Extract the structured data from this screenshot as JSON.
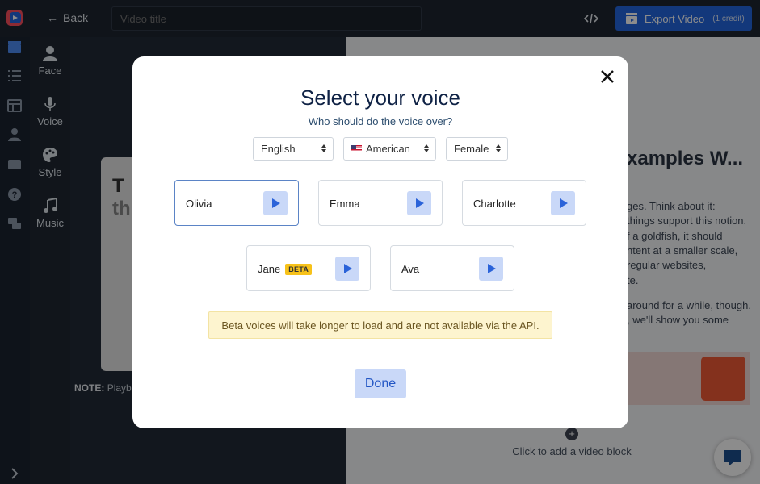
{
  "topbar": {
    "back_label": "Back",
    "title_placeholder": "Video title",
    "export_label": "Export Video",
    "export_credit": "(1 credit)"
  },
  "tools": [
    {
      "label": "Face",
      "icon": "face-icon"
    },
    {
      "label": "Voice",
      "icon": "microphone-icon"
    },
    {
      "label": "Style",
      "icon": "palette-icon"
    },
    {
      "label": "Music",
      "icon": "music-note-icon"
    }
  ],
  "preview": {
    "text_line1": "T",
    "text_line2": "th",
    "note_label": "NOTE:",
    "note_text": "Playb"
  },
  "article": {
    "heading": "xamples W...",
    "lines": [
      "ges. Think about it:",
      "things support this notion.",
      "f a goldfish, it should",
      "ntent at a smaller scale,",
      "regular websites,",
      "te.",
      "around for a while, though.",
      ", we'll show you some"
    ],
    "add_block_label": "Click to add a video block"
  },
  "modal": {
    "title": "Select your voice",
    "subtitle": "Who should do the voice over?",
    "language": "English",
    "accent": "American",
    "gender": "Female",
    "voices": [
      {
        "name": "Olivia",
        "beta": false,
        "selected": true
      },
      {
        "name": "Emma",
        "beta": false,
        "selected": false
      },
      {
        "name": "Charlotte",
        "beta": false,
        "selected": false
      },
      {
        "name": "Jane",
        "beta": true,
        "selected": false
      },
      {
        "name": "Ava",
        "beta": false,
        "selected": false
      }
    ],
    "beta_badge": "BETA",
    "warning": "Beta voices will take longer to load and are not available via the API.",
    "done_label": "Done"
  },
  "colors": {
    "primary": "#2467e0",
    "play_bg": "#c9d8f8",
    "beta_badge": "#f7c21a",
    "warning_bg": "#fdf4cf",
    "title": "#0f2245"
  }
}
